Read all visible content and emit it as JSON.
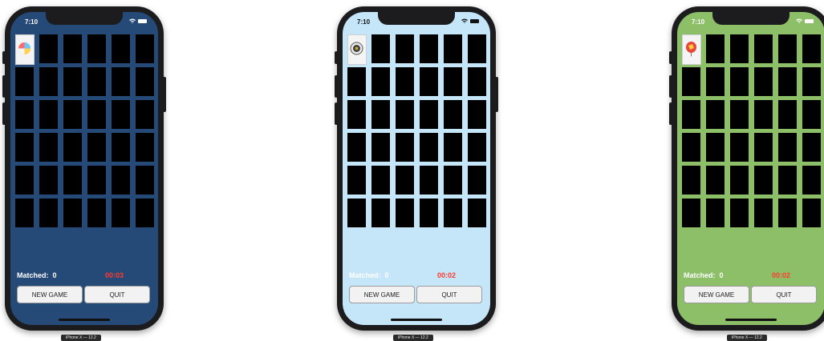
{
  "phones": [
    {
      "time": "7:10",
      "status_icons": "wifi-icon battery-icon",
      "background": "#264a78",
      "theme_icon": "beach-ball-icon",
      "matched_label": "Matched:",
      "matched_value": "0",
      "timer": "00:03",
      "new_game_label": "NEW GAME",
      "quit_label": "QUIT",
      "device_label": "iPhone X — 12.2"
    },
    {
      "time": "7:10",
      "status_icons": "wifi-icon battery-icon",
      "background": "#c4e6f8",
      "theme_icon": "badge-seal-icon",
      "matched_label": "Matched:",
      "matched_value": "0",
      "timer": "00:02",
      "new_game_label": "NEW GAME",
      "quit_label": "QUIT",
      "device_label": "iPhone X — 12.2"
    },
    {
      "time": "7:10",
      "status_icons": "wifi-icon battery-icon",
      "background": "#8cbf67",
      "theme_icon": "balloon-icon",
      "matched_label": "Matched:",
      "matched_value": "0",
      "timer": "00:02",
      "new_game_label": "NEW GAME",
      "quit_label": "QUIT",
      "device_label": "iPhone X — 12.2"
    }
  ],
  "grid": {
    "columns": 6,
    "rows": 6
  },
  "colors": {
    "card": "#000000",
    "timer": "#ff3b30"
  }
}
